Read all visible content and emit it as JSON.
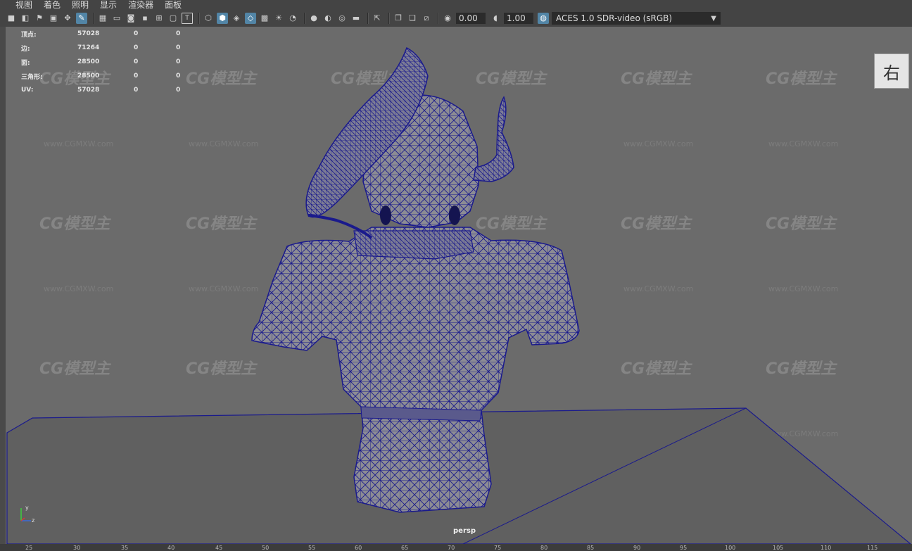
{
  "menu": [
    "视图",
    "着色",
    "照明",
    "显示",
    "渲染器",
    "面板"
  ],
  "toolbar": {
    "exposure": "0.00",
    "gamma": "1.00",
    "color_space": "ACES 1.0 SDR-video (sRGB)"
  },
  "hud": {
    "rows": [
      {
        "label": "顶点:",
        "v1": "57028",
        "v2": "0",
        "v3": "0"
      },
      {
        "label": "边:",
        "v1": "71264",
        "v2": "0",
        "v3": "0"
      },
      {
        "label": "面:",
        "v1": "28500",
        "v2": "0",
        "v3": "0"
      },
      {
        "label": "三角形:",
        "v1": "28500",
        "v2": "0",
        "v3": "0"
      },
      {
        "label": "UV:",
        "v1": "57028",
        "v2": "0",
        "v3": "0"
      }
    ]
  },
  "viewcube_label": "右",
  "camera_label": "persp",
  "axis": {
    "y": "y",
    "z": "z"
  },
  "watermark": {
    "logo": "CG模型主",
    "url": "www.CGMXW.com"
  },
  "ruler": [
    "25",
    "30",
    "35",
    "40",
    "45",
    "50",
    "55",
    "60",
    "65",
    "70",
    "75",
    "80",
    "85",
    "90",
    "95",
    "100",
    "105",
    "110",
    "115"
  ],
  "colors": {
    "wire": "#1a1a8c",
    "viewport": "#6b6b6b",
    "active": "#5285a6"
  }
}
